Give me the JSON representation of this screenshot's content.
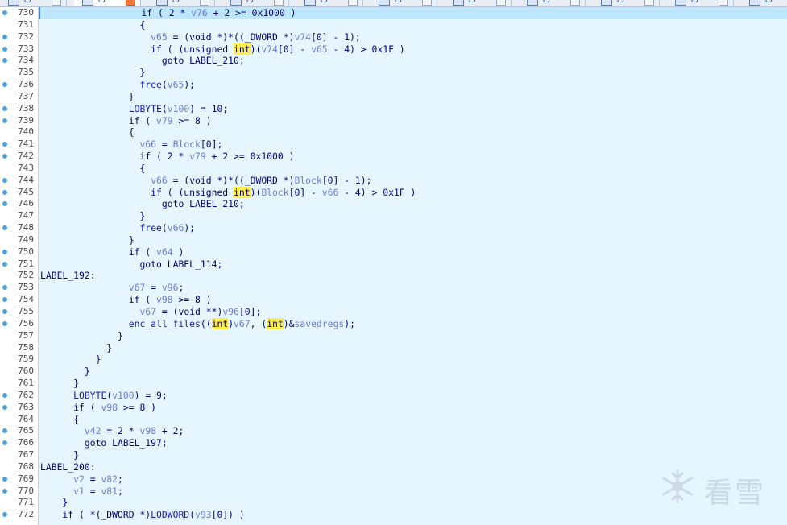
{
  "tabs": [
    {
      "label": "13",
      "active": false
    },
    {
      "label": "13",
      "active": true
    },
    {
      "label": "13",
      "active": false
    },
    {
      "label": "13",
      "active": false
    },
    {
      "label": "13",
      "active": false
    },
    {
      "label": "13",
      "active": false
    },
    {
      "label": "13",
      "active": false
    },
    {
      "label": "13",
      "active": false
    },
    {
      "label": "13",
      "active": false
    },
    {
      "label": "13",
      "active": false
    },
    {
      "label": "13",
      "active": false
    },
    {
      "label": "13",
      "active": false
    }
  ],
  "current_line": 730,
  "lines": [
    {
      "n": "730",
      "dot": true,
      "tokens": [
        [
          "p",
          "                  if ( 2 * "
        ],
        [
          "v",
          "v76"
        ],
        [
          "p",
          " + 2 >= 0x1000 )"
        ]
      ]
    },
    {
      "n": "731",
      "dot": false,
      "tokens": [
        [
          "p",
          "                  {"
        ]
      ]
    },
    {
      "n": "732",
      "dot": true,
      "tokens": [
        [
          "p",
          "                    "
        ],
        [
          "v",
          "v65"
        ],
        [
          "p",
          " = (void *)*((_DWORD *)"
        ],
        [
          "v",
          "v74"
        ],
        [
          "p",
          "[0] - 1);"
        ]
      ]
    },
    {
      "n": "733",
      "dot": true,
      "tokens": [
        [
          "p",
          "                    if ( (unsigned "
        ],
        [
          "h",
          "int"
        ],
        [
          "p",
          ")("
        ],
        [
          "v",
          "v74"
        ],
        [
          "p",
          "[0] - "
        ],
        [
          "v",
          "v65"
        ],
        [
          "p",
          " - 4) > 0x1F )"
        ]
      ]
    },
    {
      "n": "734",
      "dot": true,
      "tokens": [
        [
          "p",
          "                      goto LABEL_210;"
        ]
      ]
    },
    {
      "n": "735",
      "dot": false,
      "tokens": [
        [
          "p",
          "                  }"
        ]
      ]
    },
    {
      "n": "736",
      "dot": true,
      "tokens": [
        [
          "p",
          "                  "
        ],
        [
          "f",
          "free"
        ],
        [
          "p",
          "("
        ],
        [
          "v",
          "v65"
        ],
        [
          "p",
          ");"
        ]
      ]
    },
    {
      "n": "737",
      "dot": false,
      "tokens": [
        [
          "p",
          "                }"
        ]
      ]
    },
    {
      "n": "738",
      "dot": true,
      "tokens": [
        [
          "p",
          "                "
        ],
        [
          "f",
          "LOBYTE"
        ],
        [
          "p",
          "("
        ],
        [
          "v",
          "v100"
        ],
        [
          "p",
          ") = 10;"
        ]
      ]
    },
    {
      "n": "739",
      "dot": true,
      "tokens": [
        [
          "p",
          "                if ( "
        ],
        [
          "v",
          "v79"
        ],
        [
          "p",
          " >= 8 )"
        ]
      ]
    },
    {
      "n": "740",
      "dot": false,
      "tokens": [
        [
          "p",
          "                {"
        ]
      ]
    },
    {
      "n": "741",
      "dot": true,
      "tokens": [
        [
          "p",
          "                  "
        ],
        [
          "v",
          "v66"
        ],
        [
          "p",
          " = "
        ],
        [
          "v",
          "Block"
        ],
        [
          "p",
          "[0];"
        ]
      ]
    },
    {
      "n": "742",
      "dot": true,
      "tokens": [
        [
          "p",
          "                  if ( 2 * "
        ],
        [
          "v",
          "v79"
        ],
        [
          "p",
          " + 2 >= 0x1000 )"
        ]
      ]
    },
    {
      "n": "743",
      "dot": false,
      "tokens": [
        [
          "p",
          "                  {"
        ]
      ]
    },
    {
      "n": "744",
      "dot": true,
      "tokens": [
        [
          "p",
          "                    "
        ],
        [
          "v",
          "v66"
        ],
        [
          "p",
          " = (void *)*((_DWORD *)"
        ],
        [
          "v",
          "Block"
        ],
        [
          "p",
          "[0] - 1);"
        ]
      ]
    },
    {
      "n": "745",
      "dot": true,
      "tokens": [
        [
          "p",
          "                    if ( (unsigned "
        ],
        [
          "h",
          "int"
        ],
        [
          "p",
          ")("
        ],
        [
          "v",
          "Block"
        ],
        [
          "p",
          "[0] - "
        ],
        [
          "v",
          "v66"
        ],
        [
          "p",
          " - 4) > 0x1F )"
        ]
      ]
    },
    {
      "n": "746",
      "dot": true,
      "tokens": [
        [
          "p",
          "                      goto LABEL_210;"
        ]
      ]
    },
    {
      "n": "747",
      "dot": false,
      "tokens": [
        [
          "p",
          "                  }"
        ]
      ]
    },
    {
      "n": "748",
      "dot": true,
      "tokens": [
        [
          "p",
          "                  "
        ],
        [
          "f",
          "free"
        ],
        [
          "p",
          "("
        ],
        [
          "v",
          "v66"
        ],
        [
          "p",
          ");"
        ]
      ]
    },
    {
      "n": "749",
      "dot": false,
      "tokens": [
        [
          "p",
          "                }"
        ]
      ]
    },
    {
      "n": "750",
      "dot": true,
      "tokens": [
        [
          "p",
          "                if ( "
        ],
        [
          "v",
          "v64"
        ],
        [
          "p",
          " )"
        ]
      ]
    },
    {
      "n": "751",
      "dot": true,
      "tokens": [
        [
          "p",
          "                  goto LABEL_114;"
        ]
      ]
    },
    {
      "n": "752",
      "dot": false,
      "tokens": [
        [
          "p",
          "LABEL_192:"
        ]
      ]
    },
    {
      "n": "753",
      "dot": true,
      "tokens": [
        [
          "p",
          "                "
        ],
        [
          "v",
          "v67"
        ],
        [
          "p",
          " = "
        ],
        [
          "v",
          "v96"
        ],
        [
          "p",
          ";"
        ]
      ]
    },
    {
      "n": "754",
      "dot": true,
      "tokens": [
        [
          "p",
          "                if ( "
        ],
        [
          "v",
          "v98"
        ],
        [
          "p",
          " >= 8 )"
        ]
      ]
    },
    {
      "n": "755",
      "dot": true,
      "tokens": [
        [
          "p",
          "                  "
        ],
        [
          "v",
          "v67"
        ],
        [
          "p",
          " = (void **)"
        ],
        [
          "v",
          "v96"
        ],
        [
          "p",
          "[0];"
        ]
      ]
    },
    {
      "n": "756",
      "dot": true,
      "tokens": [
        [
          "p",
          "                "
        ],
        [
          "f",
          "enc_all_files"
        ],
        [
          "p",
          "(("
        ],
        [
          "h",
          "int"
        ],
        [
          "p",
          ")"
        ],
        [
          "v",
          "v67"
        ],
        [
          "p",
          ", ("
        ],
        [
          "h",
          "int"
        ],
        [
          "p",
          ")&"
        ],
        [
          "v",
          "savedregs"
        ],
        [
          "p",
          ");"
        ]
      ]
    },
    {
      "n": "757",
      "dot": false,
      "tokens": [
        [
          "p",
          "              }"
        ]
      ]
    },
    {
      "n": "758",
      "dot": false,
      "tokens": [
        [
          "p",
          "            }"
        ]
      ]
    },
    {
      "n": "759",
      "dot": false,
      "tokens": [
        [
          "p",
          "          }"
        ]
      ]
    },
    {
      "n": "760",
      "dot": false,
      "tokens": [
        [
          "p",
          "        }"
        ]
      ]
    },
    {
      "n": "761",
      "dot": false,
      "tokens": [
        [
          "p",
          "      }"
        ]
      ]
    },
    {
      "n": "762",
      "dot": true,
      "tokens": [
        [
          "p",
          "      "
        ],
        [
          "f",
          "LOBYTE"
        ],
        [
          "p",
          "("
        ],
        [
          "v",
          "v100"
        ],
        [
          "p",
          ") = 9;"
        ]
      ]
    },
    {
      "n": "763",
      "dot": true,
      "tokens": [
        [
          "p",
          "      if ( "
        ],
        [
          "v",
          "v98"
        ],
        [
          "p",
          " >= 8 )"
        ]
      ]
    },
    {
      "n": "764",
      "dot": false,
      "tokens": [
        [
          "p",
          "      {"
        ]
      ]
    },
    {
      "n": "765",
      "dot": true,
      "tokens": [
        [
          "p",
          "        "
        ],
        [
          "v",
          "v42"
        ],
        [
          "p",
          " = 2 * "
        ],
        [
          "v",
          "v98"
        ],
        [
          "p",
          " + 2;"
        ]
      ]
    },
    {
      "n": "766",
      "dot": true,
      "tokens": [
        [
          "p",
          "        goto LABEL_197;"
        ]
      ]
    },
    {
      "n": "767",
      "dot": false,
      "tokens": [
        [
          "p",
          "      }"
        ]
      ]
    },
    {
      "n": "768",
      "dot": false,
      "tokens": [
        [
          "p",
          "LABEL_200:"
        ]
      ]
    },
    {
      "n": "769",
      "dot": true,
      "tokens": [
        [
          "p",
          "      "
        ],
        [
          "v",
          "v2"
        ],
        [
          "p",
          " = "
        ],
        [
          "v",
          "v82"
        ],
        [
          "p",
          ";"
        ]
      ]
    },
    {
      "n": "770",
      "dot": true,
      "tokens": [
        [
          "p",
          "      "
        ],
        [
          "v",
          "v1"
        ],
        [
          "p",
          " = "
        ],
        [
          "v",
          "v81"
        ],
        [
          "p",
          ";"
        ]
      ]
    },
    {
      "n": "771",
      "dot": false,
      "tokens": [
        [
          "p",
          "    }"
        ]
      ]
    },
    {
      "n": "772",
      "dot": true,
      "tokens": [
        [
          "p",
          "    if ( *(_DWORD *)"
        ],
        [
          "f",
          "LODWORD"
        ],
        [
          "p",
          "("
        ],
        [
          "v",
          "v93"
        ],
        [
          "p",
          "[0]) )"
        ]
      ]
    }
  ],
  "watermark": {
    "text": "看雪",
    "icon": "kanxue-snowflake-icon"
  }
}
